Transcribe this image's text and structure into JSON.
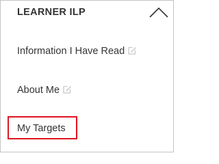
{
  "panel": {
    "title": "LEARNER ILP",
    "toggle_icon": "chevron-up-icon"
  },
  "nav": {
    "items": [
      {
        "label": "Information I Have Read",
        "icon": "edit-icon"
      },
      {
        "label": "About Me",
        "icon": "edit-icon"
      },
      {
        "label": "My Targets",
        "highlighted": true
      }
    ]
  },
  "colors": {
    "text": "#333333",
    "highlight": "#e0141e",
    "border": "#c4c4c4",
    "icon": "#c8c8c8"
  }
}
